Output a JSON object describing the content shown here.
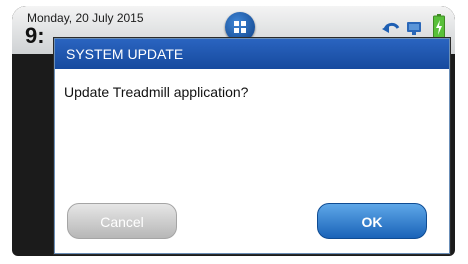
{
  "statusbar": {
    "date": "Monday, 20 July 2015",
    "time": "9:"
  },
  "icons": {
    "home": "home-grid-icon",
    "back": "back-arrow-icon",
    "monitor": "monitor-icon",
    "battery": "battery-icon"
  },
  "colors": {
    "dialog_header": "#1f56ae",
    "ok_button": "#2f7fd0",
    "cancel_button": "#c9c9c9",
    "battery": "#4caf2e"
  },
  "dialog": {
    "title": "SYSTEM UPDATE",
    "message": "Update Treadmill application?",
    "cancel_label": "Cancel",
    "ok_label": "OK"
  }
}
